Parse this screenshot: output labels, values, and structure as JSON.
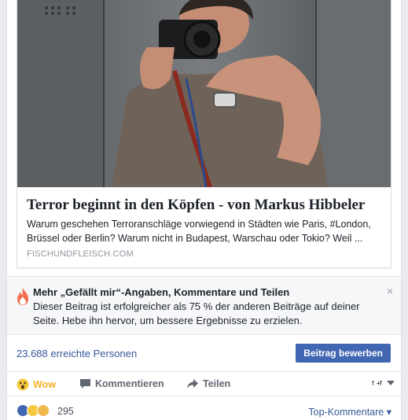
{
  "link_preview": {
    "title": "Terror beginnt in den Köpfen - von Markus Hibbeler",
    "description": "Warum geschehen Terroranschläge vorwiegend in Städten wie Paris, #London, Brüssel oder Berlin? Warum nicht in Budapest, Warschau oder Tokio? Weil ...",
    "domain": "FISCHUNDFLEISCH.COM"
  },
  "boost_tip": {
    "title": "Mehr „Gefällt mir“-Angaben, Kommentare und Teilen",
    "text": "Dieser Beitrag ist erfolgreicher als 75 % der anderen Beiträge auf deiner Seite. Hebe ihn hervor, um bessere Ergebnisse zu erzielen.",
    "close_label": "×"
  },
  "reach": {
    "text": "23.688 erreichte Personen",
    "boost_button": "Beitrag bewerben"
  },
  "actions": {
    "wow": "Wow",
    "comment": "Kommentieren",
    "share": "Teilen"
  },
  "reactions": {
    "count": "295",
    "top_comments": "Top-Kommentare"
  },
  "colors": {
    "link_blue": "#365899",
    "button_blue": "#4267b2",
    "wow_yellow": "#f7b125",
    "muted_gray": "#90949c"
  }
}
